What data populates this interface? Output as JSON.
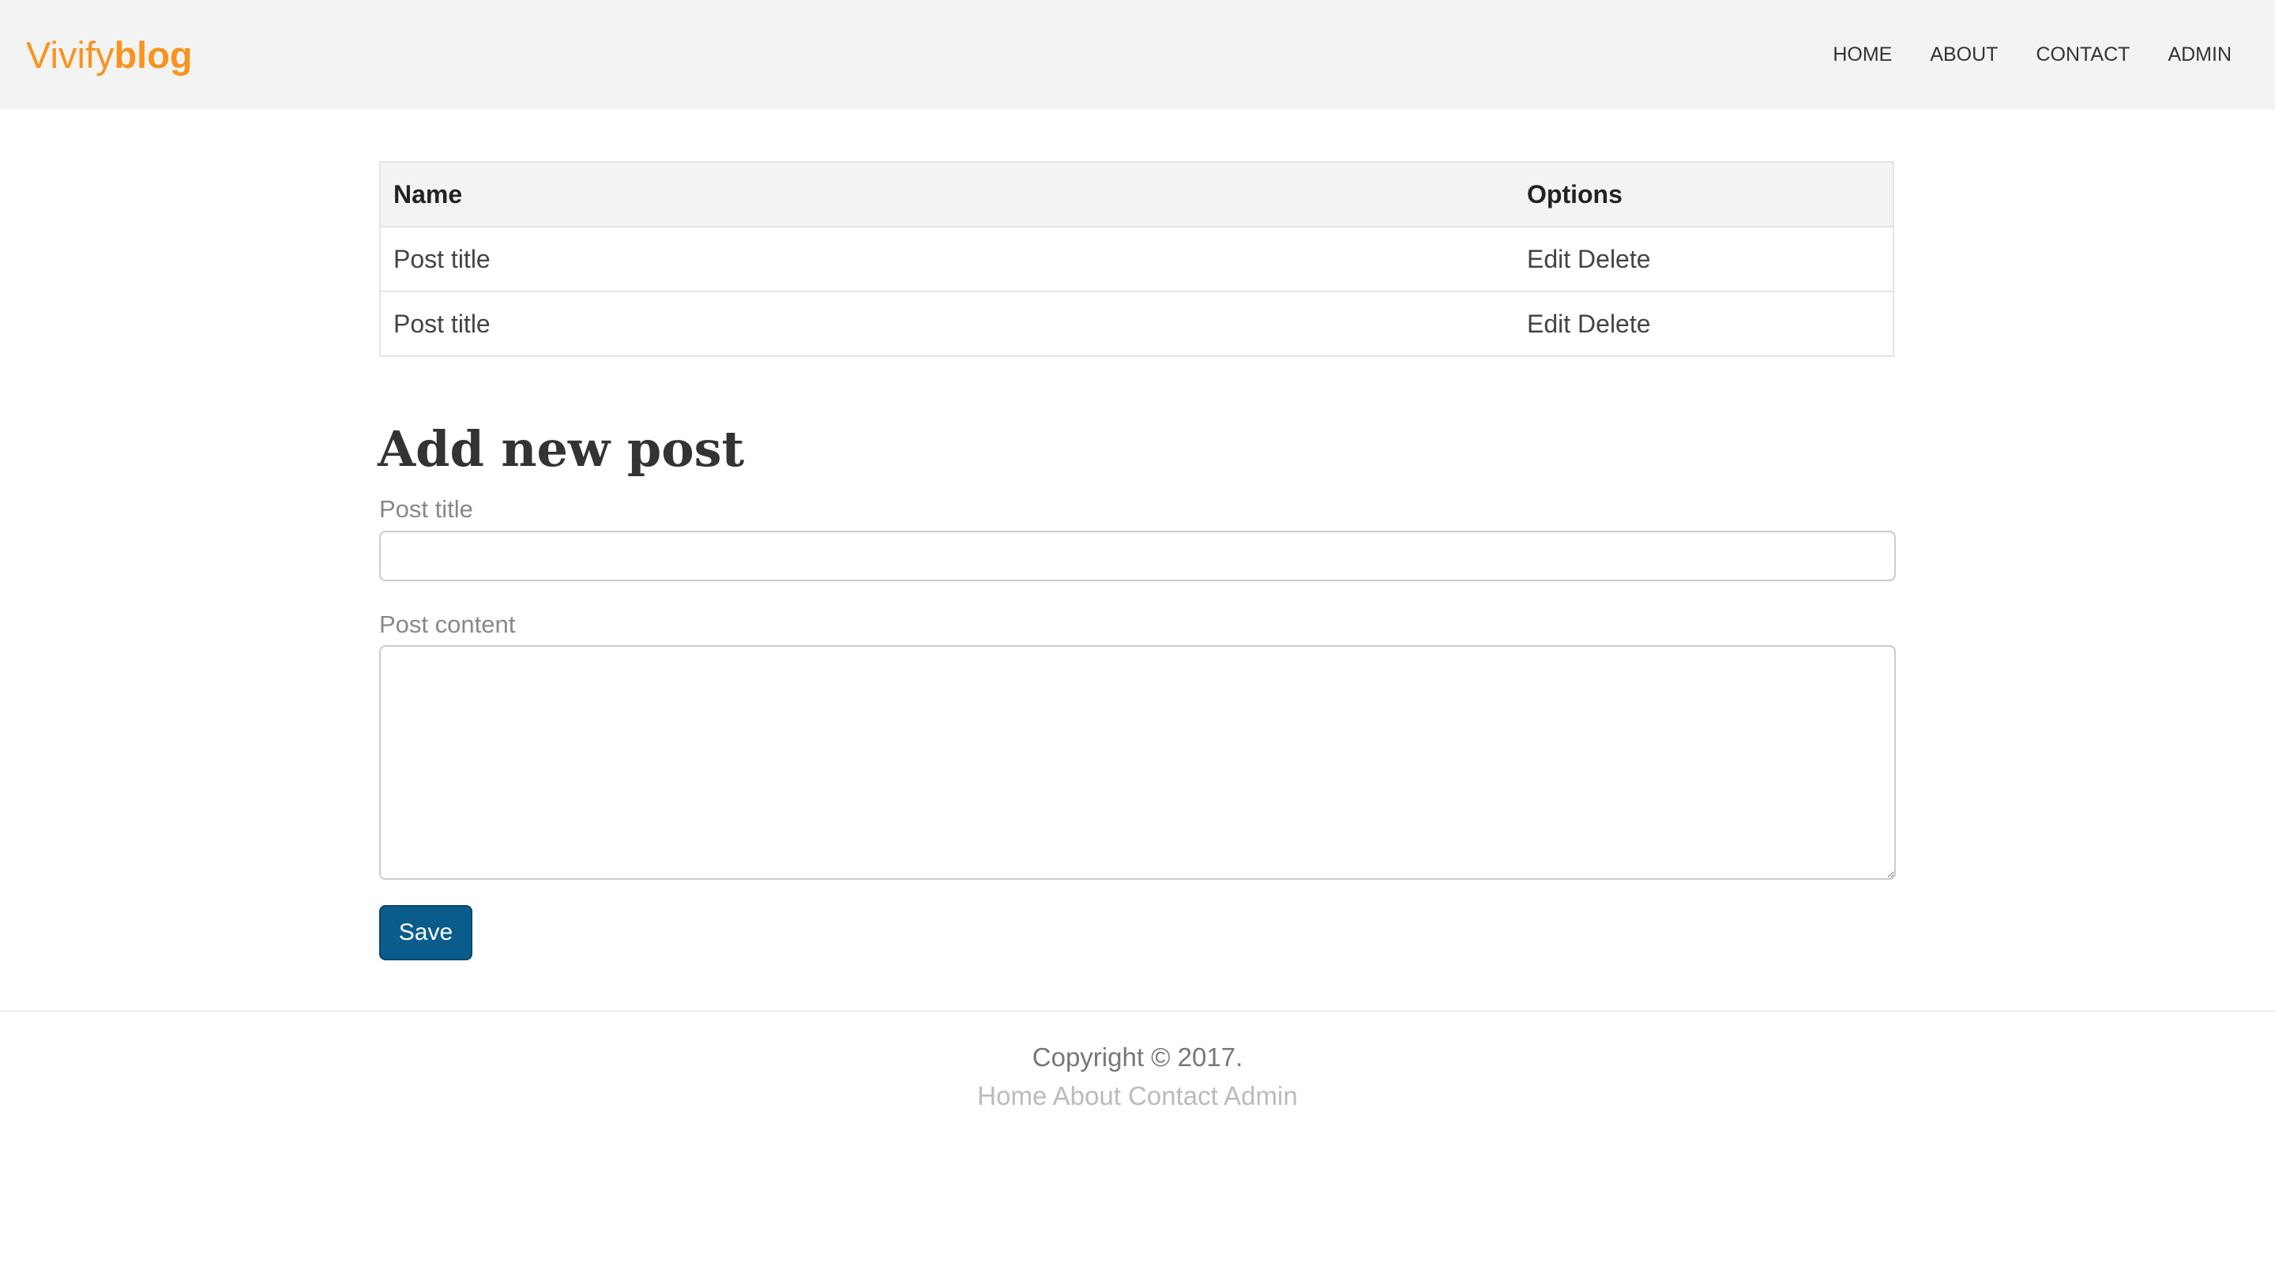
{
  "brand": {
    "part1": "Vivify",
    "part2": "blog",
    "color": "#f7941d"
  },
  "nav": {
    "items": [
      "HOME",
      "ABOUT",
      "CONTACT",
      "ADMIN"
    ]
  },
  "table": {
    "headers": {
      "name": "Name",
      "options": "Options"
    },
    "rows": [
      {
        "title": "Post title",
        "edit": "Edit",
        "delete": "Delete"
      },
      {
        "title": "Post title",
        "edit": "Edit",
        "delete": "Delete"
      }
    ]
  },
  "form": {
    "heading": "Add new post",
    "title_label": "Post title",
    "title_value": "",
    "content_label": "Post content",
    "content_value": "",
    "save_label": "Save",
    "save_color": "#0a5c8c"
  },
  "footer": {
    "copyright": "Copyright © 2017.",
    "links": [
      "Home",
      "About",
      "Contact",
      "Admin"
    ]
  }
}
